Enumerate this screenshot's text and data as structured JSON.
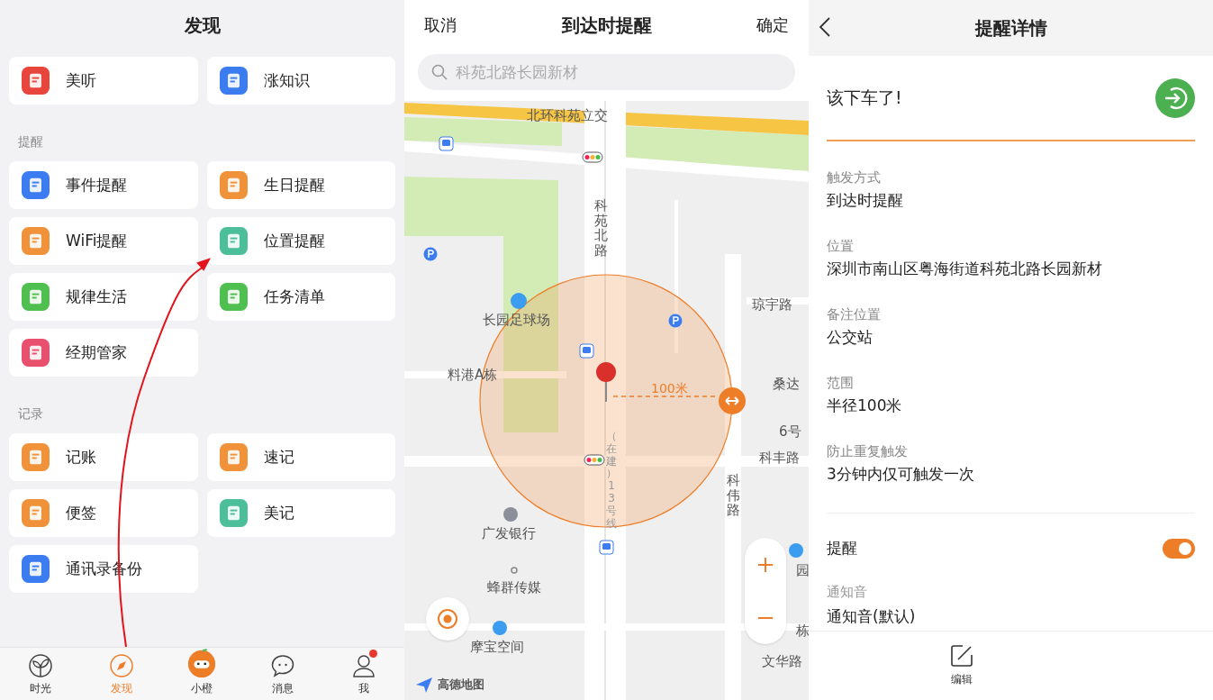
{
  "discover": {
    "title": "发现",
    "top_tiles": [
      {
        "label": "美听",
        "color": "#e8453c"
      },
      {
        "label": "涨知识",
        "color": "#3b7cf0"
      }
    ],
    "sections": [
      {
        "label": "提醒",
        "tiles": [
          {
            "label": "事件提醒",
            "color": "#3b7cf0"
          },
          {
            "label": "生日提醒",
            "color": "#f0923a"
          },
          {
            "label": "WiFi提醒",
            "color": "#f0923a"
          },
          {
            "label": "位置提醒",
            "color": "#4cbf9a"
          },
          {
            "label": "规律生活",
            "color": "#4fbf4f"
          },
          {
            "label": "任务清单",
            "color": "#4fbf4f"
          },
          {
            "label": "经期管家",
            "color": "#e8506e"
          }
        ]
      },
      {
        "label": "记录",
        "tiles": [
          {
            "label": "记账",
            "color": "#f0923a"
          },
          {
            "label": "速记",
            "color": "#f0923a"
          },
          {
            "label": "便签",
            "color": "#f0923a"
          },
          {
            "label": "美记",
            "color": "#4cbf9a"
          },
          {
            "label": "通讯录备份",
            "color": "#3b7cf0"
          }
        ]
      }
    ],
    "tab_bar": [
      {
        "label": "时光",
        "selected": false,
        "badge": false
      },
      {
        "label": "发现",
        "selected": true,
        "badge": false
      },
      {
        "label": "小橙",
        "selected": false,
        "badge": false
      },
      {
        "label": "消息",
        "selected": false,
        "badge": false
      },
      {
        "label": "我",
        "selected": false,
        "badge": true
      }
    ]
  },
  "location_picker": {
    "cancel": "取消",
    "title": "到达时提醒",
    "confirm": "确定",
    "search": {
      "placeholder": "科苑北路长园新材"
    },
    "map": {
      "radius_label": "100米",
      "logo": "高德地图",
      "labels": [
        {
          "text": "北环科苑立交",
          "vertical": false
        },
        {
          "text": "科苑北路",
          "vertical": true
        },
        {
          "text": "长园足球场",
          "vertical": false
        },
        {
          "text": "琼宇路",
          "vertical": false
        },
        {
          "text": "料港A栋",
          "vertical": false
        },
        {
          "text": "桑达",
          "vertical": false
        },
        {
          "text": "6号",
          "vertical": false
        },
        {
          "text": "科丰路",
          "vertical": false
        },
        {
          "text": "科伟路",
          "vertical": true
        },
        {
          "text": "（在建）13号线",
          "vertical": true
        },
        {
          "text": "广发银行",
          "vertical": false
        },
        {
          "text": "蜂群传媒",
          "vertical": false
        },
        {
          "text": "园",
          "vertical": false
        },
        {
          "text": "摩宝空间",
          "vertical": false
        },
        {
          "text": "栋",
          "vertical": false
        },
        {
          "text": "文华路",
          "vertical": false
        }
      ]
    }
  },
  "detail": {
    "title": "提醒详情",
    "heading": "该下车了!",
    "fields": [
      {
        "label": "触发方式",
        "value": "到达时提醒"
      },
      {
        "label": "位置",
        "value": "深圳市南山区粤海街道科苑北路长园新材"
      },
      {
        "label": "备注位置",
        "value": "公交站"
      },
      {
        "label": "范围",
        "value": "半径100米"
      },
      {
        "label": "防止重复触发",
        "value": "3分钟内仅可触发一次"
      }
    ],
    "toggle": {
      "label": "提醒",
      "on": true
    },
    "sound": {
      "label": "通知音",
      "value": "通知音(默认)"
    },
    "edit_button": "编辑"
  }
}
